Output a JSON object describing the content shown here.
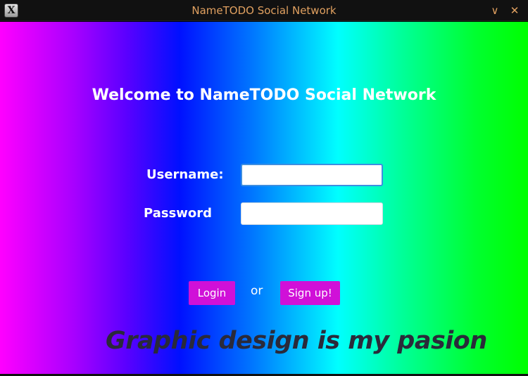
{
  "window": {
    "title": "NameTODO Social Network",
    "icon": "app-x-icon",
    "icon_glyph": "X",
    "minimize_glyph": "∨",
    "close_glyph": "✕"
  },
  "login_form": {
    "welcome": "Welcome to NameTODO Social Network",
    "username_label": "Username:",
    "username_value": "",
    "password_label": "Password",
    "password_value": "",
    "login_button": "Login",
    "or_text": "or",
    "signup_button": "Sign up!"
  },
  "tagline": "Graphic design is my pasion",
  "colors": {
    "titlebar_bg": "#111111",
    "titlebar_text": "#e0a060",
    "button_bg": "#d010d8",
    "tagline_text": "#2a2a3a",
    "gradient_stops": [
      "#ff00ff",
      "#0010ff",
      "#00ffff",
      "#00ff00"
    ]
  }
}
